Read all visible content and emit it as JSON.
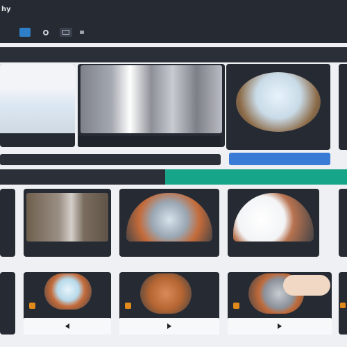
{
  "app": {
    "title": "hy"
  },
  "toolbar": {
    "buttons": [
      "menu-icon",
      "blue-square-icon",
      "settings-icon",
      "grid-icon",
      "folder-icon"
    ]
  },
  "row1": {
    "cards": [
      {
        "label": "",
        "icon": "construction-vehicle-icon"
      },
      {
        "label": "",
        "icon": "pipe-rack-icon"
      },
      {
        "label": "",
        "icon": "machine-room-icon"
      }
    ],
    "bottom_left_label": "",
    "bottom_mid_label": "",
    "bottom_right_label": ""
  },
  "banner": {
    "label": ""
  },
  "row2": {
    "cards": [
      {
        "label": ""
      },
      {
        "label": ""
      },
      {
        "label": ""
      },
      {
        "label": ""
      },
      {
        "label": ""
      }
    ]
  },
  "row3": {
    "cards": [
      {
        "label": ""
      },
      {
        "label": ""
      },
      {
        "label": ""
      },
      {
        "label": ""
      },
      {
        "label": ""
      }
    ]
  },
  "colors": {
    "accent_teal": "#17a58a",
    "accent_blue": "#3a7bd5"
  }
}
